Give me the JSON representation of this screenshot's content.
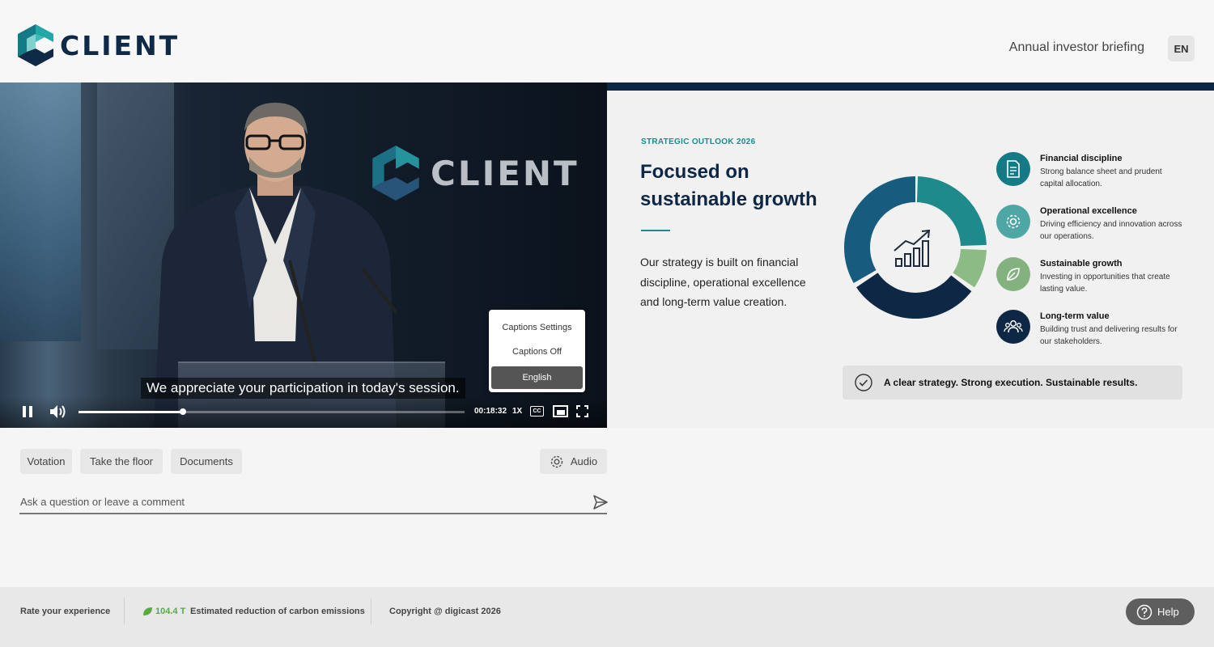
{
  "brand": {
    "name": "CLIENT",
    "accent": "#0f2a47",
    "teal": "#1a8c8c"
  },
  "header": {
    "title": "Annual investor briefing",
    "language": "EN"
  },
  "video": {
    "caption": "We appreciate your participation in today's session.",
    "stage_logo_text": "CLIENT",
    "progress": 0.27,
    "time": "00:18:32",
    "speed": "1X",
    "cc_label": "CC",
    "captions_menu": {
      "items": [
        "Captions Settings",
        "Captions Off",
        "English"
      ],
      "selected": "English"
    },
    "icons": [
      "pause-icon",
      "volume-icon",
      "cc-icon",
      "picture-in-picture-icon",
      "fullscreen-icon"
    ]
  },
  "slide": {
    "kicker": "STRATEGIC OUTLOOK 2026",
    "title": "Focused on sustainable growth",
    "body": "Our strategy is built on financial discipline, operational excellence and long-term value creation.",
    "pillars": [
      {
        "title": "Financial discipline",
        "desc": "Strong balance sheet and prudent capital allocation.",
        "icon": "document-icon",
        "color": "#137a86"
      },
      {
        "title": "Operational excellence",
        "desc": "Driving efficiency and innovation across our operations.",
        "icon": "gear-icon",
        "color": "#4fa7a5"
      },
      {
        "title": "Sustainable growth",
        "desc": "Investing in opportunities that create lasting value.",
        "icon": "leaf-icon",
        "color": "#84b27e"
      },
      {
        "title": "Long-term value",
        "desc": "Building trust and delivering results for our stakeholders.",
        "icon": "people-icon",
        "color": "#0e2744"
      }
    ],
    "donut_colors": [
      "#1f8a8c",
      "#8cbb86",
      "#0e2744",
      "#175c7e"
    ],
    "banner": "A clear strategy. Strong execution. Sustainable results."
  },
  "actions": {
    "votation": "Votation",
    "take_floor": "Take the floor",
    "documents": "Documents",
    "audio": "Audio",
    "comment_placeholder": "Ask a question or leave a comment"
  },
  "footer": {
    "rate": "Rate your experience",
    "carbon_value": "104.4 T",
    "carbon_label": "Estimated reduction of carbon emissions",
    "copyright": "Copyright @ digicast 2026",
    "help": "Help"
  }
}
